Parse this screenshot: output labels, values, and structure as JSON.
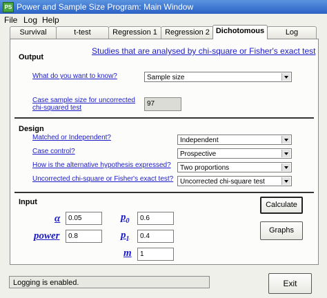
{
  "window": {
    "title": "Power and Sample Size Program: Main Window",
    "icon_text": "PS"
  },
  "menu": [
    "File",
    "Log",
    "Help"
  ],
  "tabs": [
    "Survival",
    "t-test",
    "Regression 1",
    "Regression 2",
    "Dichotomous",
    "Log"
  ],
  "active_tab": "Dichotomous",
  "header_link": "Studies that are analysed by chi-square or Fisher's exact test",
  "output": {
    "title": "Output",
    "question_label": "What do you want to know?",
    "question_value": "Sample size",
    "case_label_line1": "Case sample size for uncorrected",
    "case_label_line2": "chi-squared test",
    "case_value": "97"
  },
  "design": {
    "title": "Design",
    "matched_label": "Matched or Independent?",
    "matched_value": "Independent",
    "case_control_label": "Case control?",
    "case_control_value": "Prospective",
    "hypothesis_label": "How is the alternative hypothesis expressed?",
    "hypothesis_value": "Two proportions",
    "test_label": "Uncorrected chi-square or Fisher's exact test?",
    "test_value": "Uncorrected chi-square test"
  },
  "input": {
    "title": "Input",
    "alpha_label": "α",
    "alpha_value": "0.05",
    "power_label": "power",
    "power_value": "0.8",
    "p_label": "p",
    "p0_sub": "0",
    "p0_value": "0.6",
    "p1_sub": "1",
    "p1_value": "0.4",
    "m_label": "m",
    "m_value": "1"
  },
  "buttons": {
    "calculate": "Calculate",
    "graphs": "Graphs",
    "exit": "Exit"
  },
  "status": "Logging is enabled."
}
